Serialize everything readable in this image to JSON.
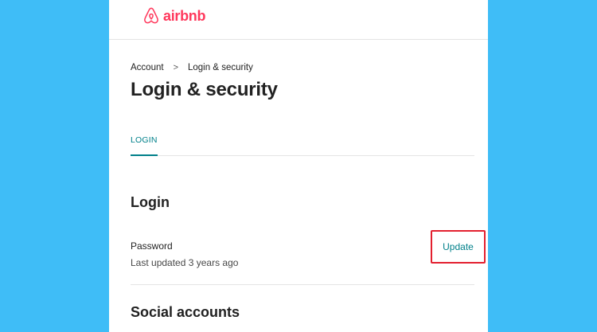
{
  "brand": {
    "name": "airbnb",
    "color": "#ff385c",
    "icon": "airbnb-logo-icon"
  },
  "breadcrumb": {
    "items": [
      "Account",
      "Login & security"
    ],
    "separator": ">"
  },
  "page": {
    "title": "Login & security"
  },
  "tabs": [
    {
      "label": "LOGIN",
      "active": true
    }
  ],
  "login_section": {
    "title": "Login",
    "password": {
      "label": "Password",
      "status": "Last updated 3 years ago",
      "action_label": "Update"
    }
  },
  "social_section": {
    "title": "Social accounts"
  },
  "colors": {
    "background": "#3fbdf7",
    "accent": "#00808a",
    "highlight_border": "#e3202f"
  }
}
